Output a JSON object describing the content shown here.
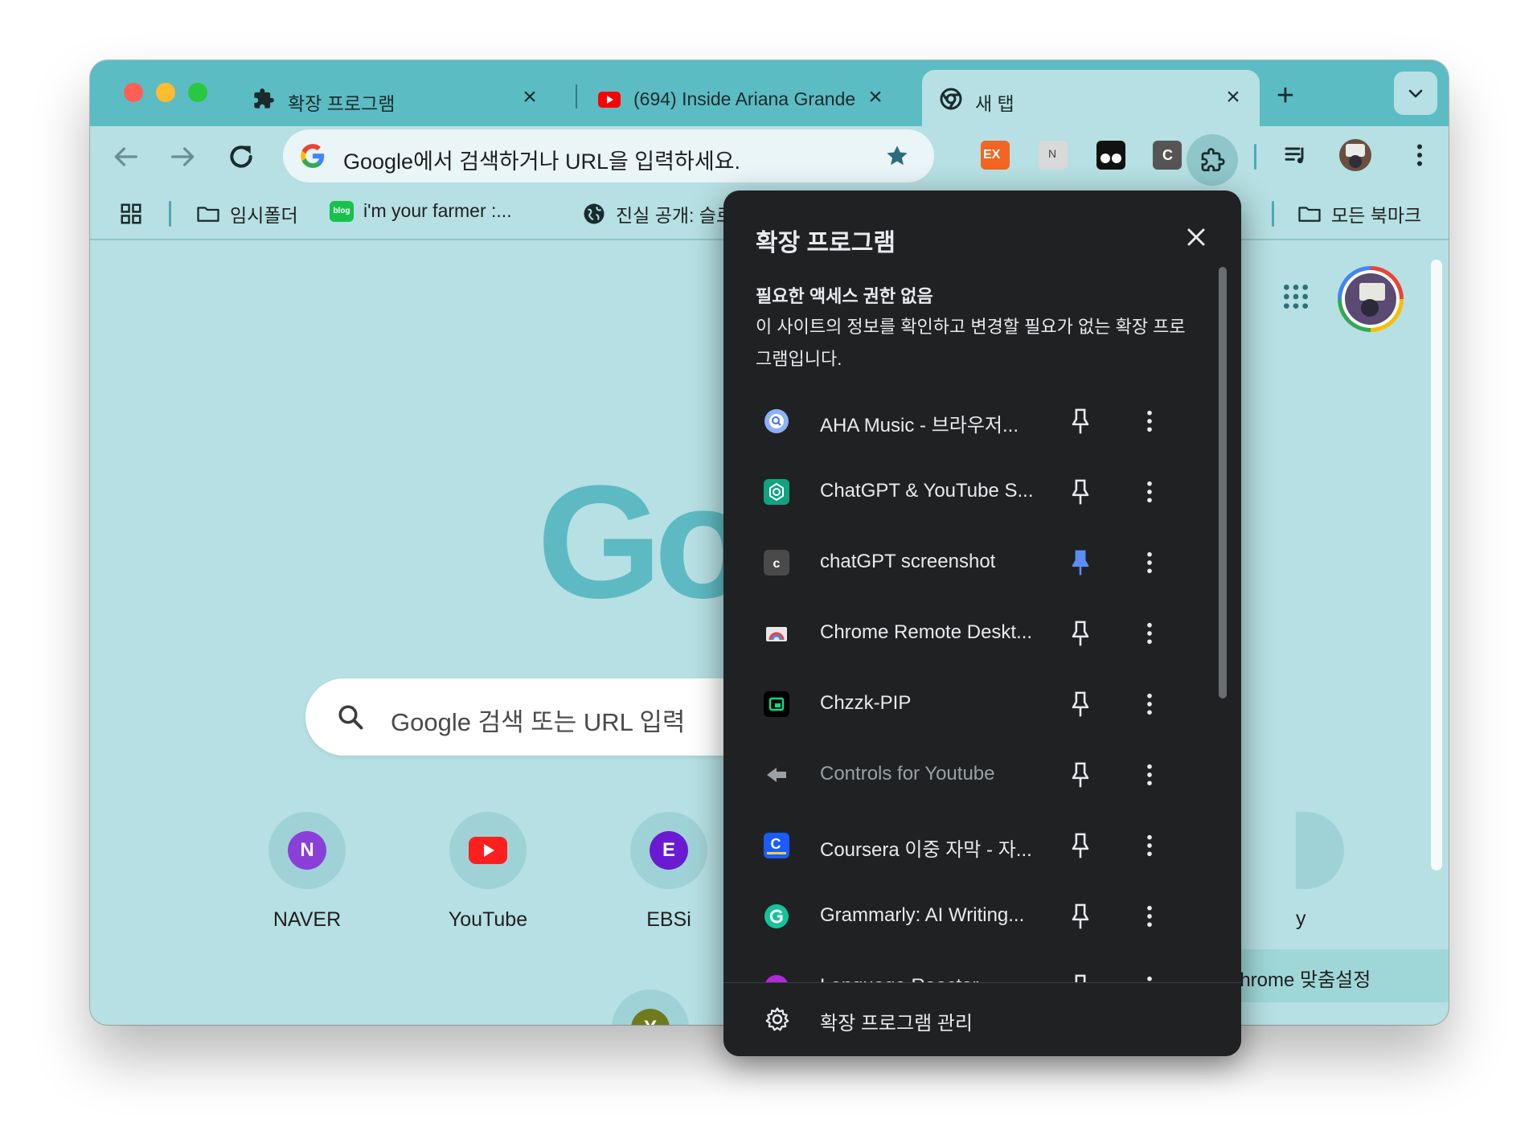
{
  "tabs": [
    {
      "title": "확장 프로그램",
      "icon": "puzzle-icon",
      "active": false
    },
    {
      "title": "(694) Inside Ariana Grande",
      "icon": "youtube-icon",
      "active": false
    },
    {
      "title": "새 탭",
      "icon": "chrome-icon",
      "active": true
    }
  ],
  "omnibox": {
    "placeholder": "Google에서 검색하거나 URL을 입력하세요."
  },
  "bookmarks": [
    {
      "label": "임시폴더",
      "icon": "folder-icon"
    },
    {
      "label": "i'm your farmer :...",
      "icon": "blog-icon"
    },
    {
      "label": "진실 공개: 슬로",
      "icon": "globe-icon"
    },
    {
      "label": "모든 북마크",
      "icon": "folder-icon"
    }
  ],
  "toolbar_extensions": [
    "EX",
    "N",
    "",
    "C"
  ],
  "ntp": {
    "logo_text": "Go",
    "search_placeholder": "Google 검색 또는 URL 입력",
    "shortcuts": [
      {
        "label": "NAVER",
        "letter": "N",
        "color": "#8a3fd8"
      },
      {
        "label": "YouTube",
        "letter": "",
        "color": "#ff1f1f"
      },
      {
        "label": "EBSi",
        "letter": "E",
        "color": "#6a1bd1"
      },
      {
        "label": "",
        "letter": "Y",
        "color": "#6f7a1c"
      }
    ],
    "partial_label": "y",
    "customize_label": "Chrome 맞춤설정"
  },
  "popup": {
    "title": "확장 프로그램",
    "section_title": "필요한 액세스 권한 없음",
    "section_desc": "이 사이트의 정보를 확인하고 변경할 필요가 없는 확장 프로그램입니다.",
    "extensions": [
      {
        "name": "AHA Music - 브라우저...",
        "pinned": false,
        "icon": "aha-music-icon",
        "color": "#5b8cf5",
        "dim": false
      },
      {
        "name": "ChatGPT & YouTube S...",
        "pinned": false,
        "icon": "chatgpt-icon",
        "color": "#10a37f",
        "dim": false
      },
      {
        "name": "chatGPT screenshot",
        "pinned": true,
        "icon": "c-icon",
        "color": "#4a4a4a",
        "dim": false
      },
      {
        "name": "Chrome Remote Deskt...",
        "pinned": false,
        "icon": "remote-desktop-icon",
        "color": "#e8e8e8",
        "dim": false
      },
      {
        "name": "Chzzk-PIP",
        "pinned": false,
        "icon": "chzzk-icon",
        "color": "#000000",
        "dim": false
      },
      {
        "name": "Controls for Youtube",
        "pinned": false,
        "icon": "arrow-icon",
        "color": "#9aa0a6",
        "dim": true
      },
      {
        "name": "Coursera 이중 자막 - 자...",
        "pinned": false,
        "icon": "coursera-icon",
        "color": "#1a5cff",
        "dim": false
      },
      {
        "name": "Grammarly: AI Writing...",
        "pinned": false,
        "icon": "grammarly-icon",
        "color": "#15c39a",
        "dim": false
      },
      {
        "name": "Language Reactor",
        "pinned": false,
        "icon": "language-reactor-icon",
        "color": "#b02bd6",
        "dim": false
      }
    ],
    "footer_label": "확장 프로그램 관리"
  },
  "colors": {
    "accent": "#5cbcc4",
    "popup_bg": "#1f2123",
    "pin_active": "#5b8ef2"
  }
}
